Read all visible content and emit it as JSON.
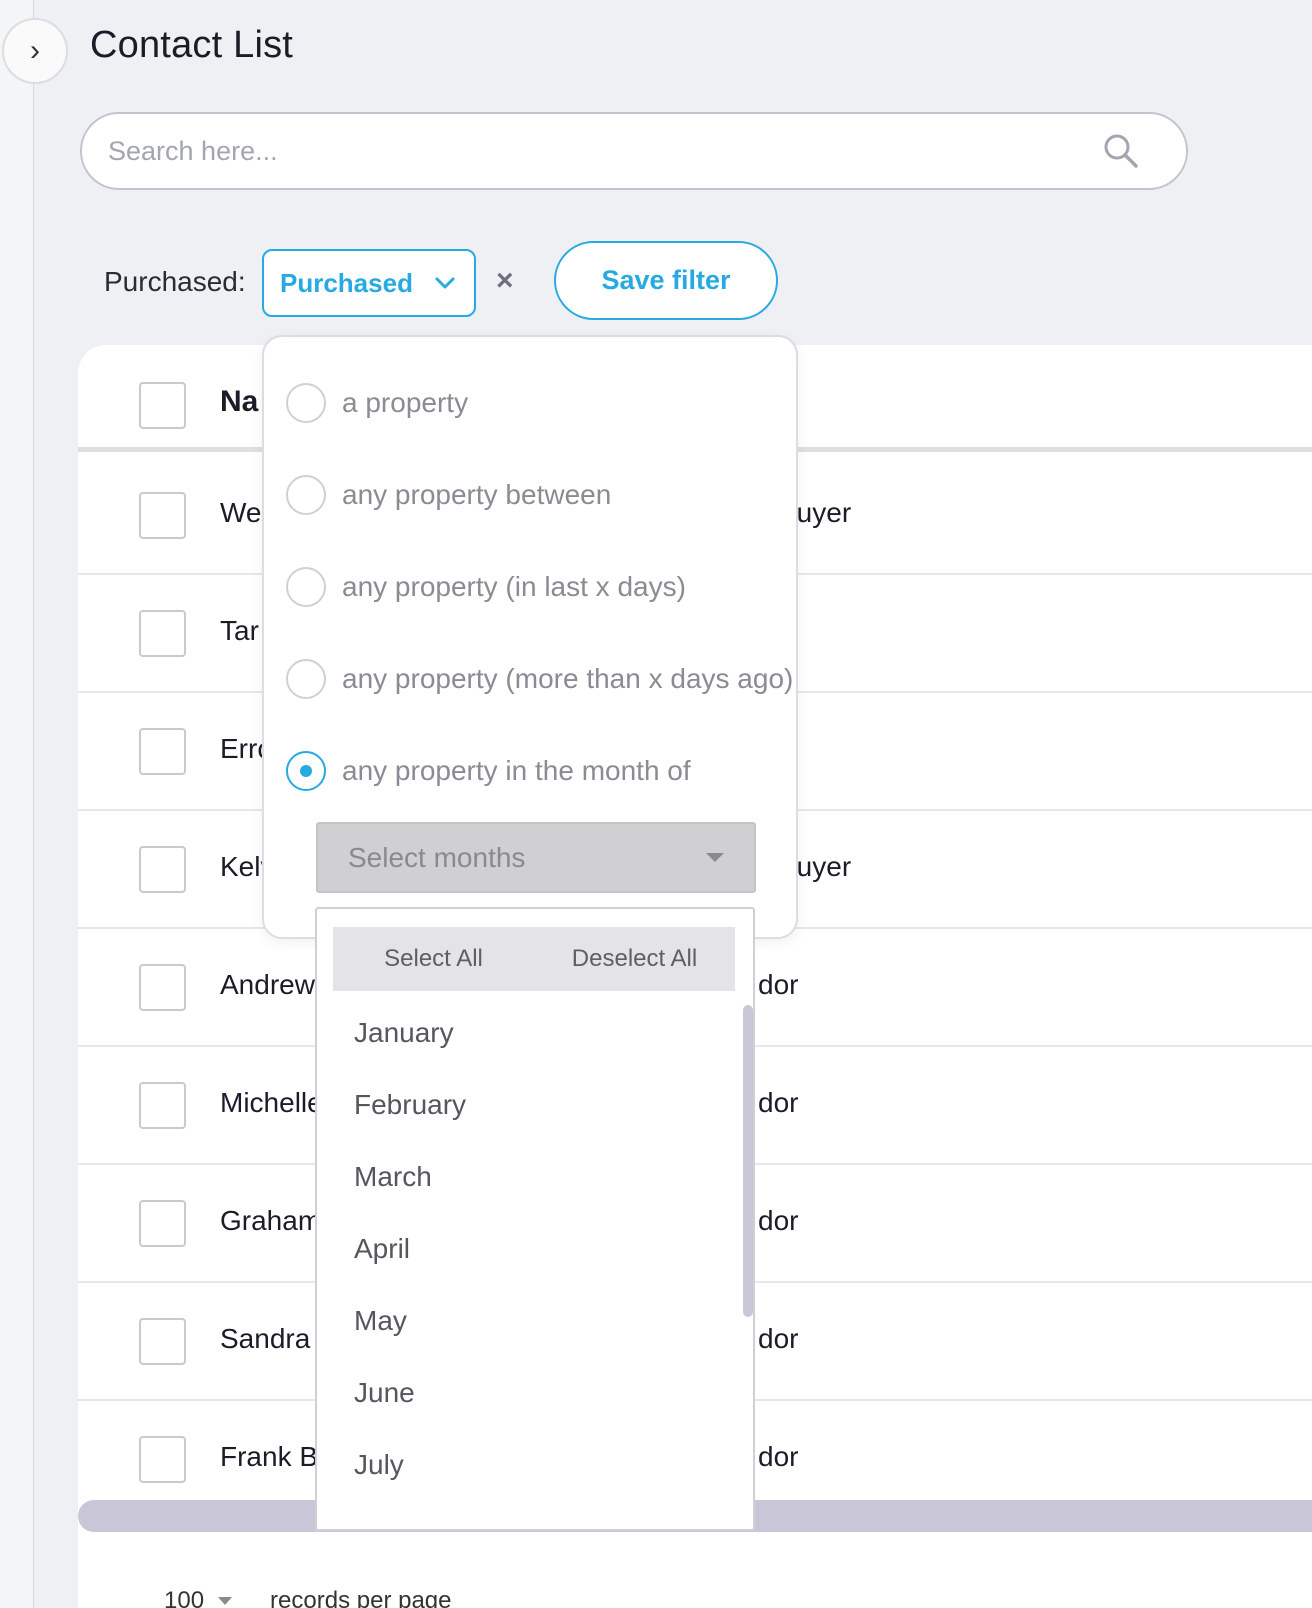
{
  "page": {
    "title": "Contact List",
    "collapse_glyph": "›"
  },
  "search": {
    "placeholder": "Search here..."
  },
  "filter": {
    "label": "Purchased:",
    "selected": "Purchased",
    "clear_glyph": "×",
    "save_label": "Save filter"
  },
  "table": {
    "header_name": "Na",
    "rows": [
      {
        "name": "We",
        "type": "Buyer"
      },
      {
        "name": "Tar",
        "type": ""
      },
      {
        "name": "Erro",
        "type": ""
      },
      {
        "name": "Kelv",
        "type": "Buyer"
      },
      {
        "name": "Andrew",
        "type": "dor"
      },
      {
        "name": "Michelle",
        "type": "dor"
      },
      {
        "name": "Graham",
        "type": "dor"
      },
      {
        "name": "Sandra",
        "type": "dor"
      },
      {
        "name": "Frank B.",
        "type": "dor"
      }
    ]
  },
  "purchase_options": {
    "items": [
      {
        "label": "a property",
        "selected": false
      },
      {
        "label": "any property between",
        "selected": false
      },
      {
        "label": "any property (in last x days)",
        "selected": false
      },
      {
        "label": "any property (more than x days ago)",
        "selected": false
      },
      {
        "label": "any property in the month of",
        "selected": true
      }
    ],
    "month_select_placeholder": "Select months"
  },
  "months_dropdown": {
    "select_all": "Select All",
    "deselect_all": "Deselect All",
    "months": [
      "January",
      "February",
      "March",
      "April",
      "May",
      "June",
      "July"
    ]
  },
  "footer": {
    "per_page": "100",
    "records_label": "records per page"
  },
  "colors": {
    "accent": "#27a9e1",
    "background": "#eef0f3"
  }
}
